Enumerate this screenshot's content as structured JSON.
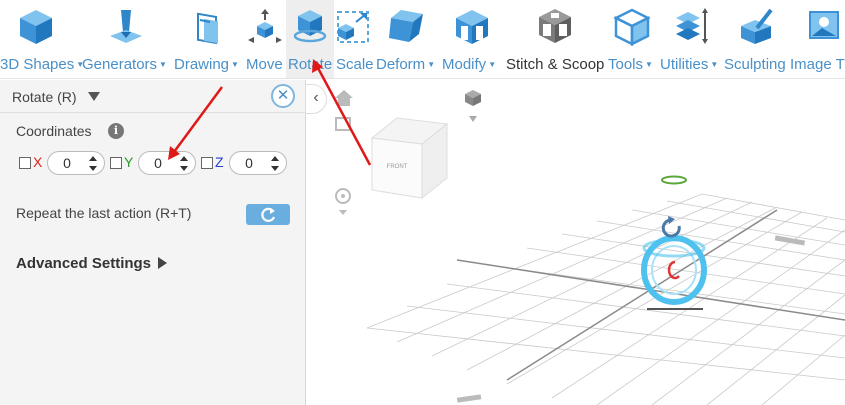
{
  "toolbar": {
    "items": [
      {
        "label": "3D Shapes",
        "icon": "cube-icon",
        "dropdown": true
      },
      {
        "label": "Generators",
        "icon": "generator-icon",
        "dropdown": true
      },
      {
        "label": "Drawing",
        "icon": "drawing-icon",
        "dropdown": true
      },
      {
        "label": "Move",
        "icon": "move-icon",
        "dropdown": false
      },
      {
        "label": "Rotate",
        "icon": "rotate-icon",
        "dropdown": false,
        "active": true
      },
      {
        "label": "Scale",
        "icon": "scale-icon",
        "dropdown": false
      },
      {
        "label": "Deform",
        "icon": "deform-icon",
        "dropdown": true
      },
      {
        "label": "Modify",
        "icon": "modify-icon",
        "dropdown": true
      },
      {
        "label": "Stitch & Scoop",
        "icon": "stitch-scoop-icon",
        "dropdown": false
      },
      {
        "label": "Tools",
        "icon": "tools-icon",
        "dropdown": true
      },
      {
        "label": "Utilities",
        "icon": "utilities-icon",
        "dropdown": true
      },
      {
        "label": "Sculpting",
        "icon": "sculpting-icon",
        "dropdown": false
      },
      {
        "label": "Image T",
        "icon": "image-icon",
        "dropdown": false
      }
    ]
  },
  "panel": {
    "title": "Rotate (R)",
    "coordinates_label": "Coordinates",
    "axes": [
      {
        "axis": "X",
        "value": "0",
        "color": "#e02020"
      },
      {
        "axis": "Y",
        "value": "0",
        "color": "#2a9a2a"
      },
      {
        "axis": "Z",
        "value": "0",
        "color": "#2a40d0"
      }
    ],
    "repeat_label": "Repeat the last action (R+T)",
    "advanced_label": "Advanced Settings"
  },
  "viewcube": {
    "face_label": "FRONT"
  },
  "colors": {
    "accent": "#4a90c8",
    "button": "#6aaedf",
    "annotation_arrow": "#e01818"
  }
}
